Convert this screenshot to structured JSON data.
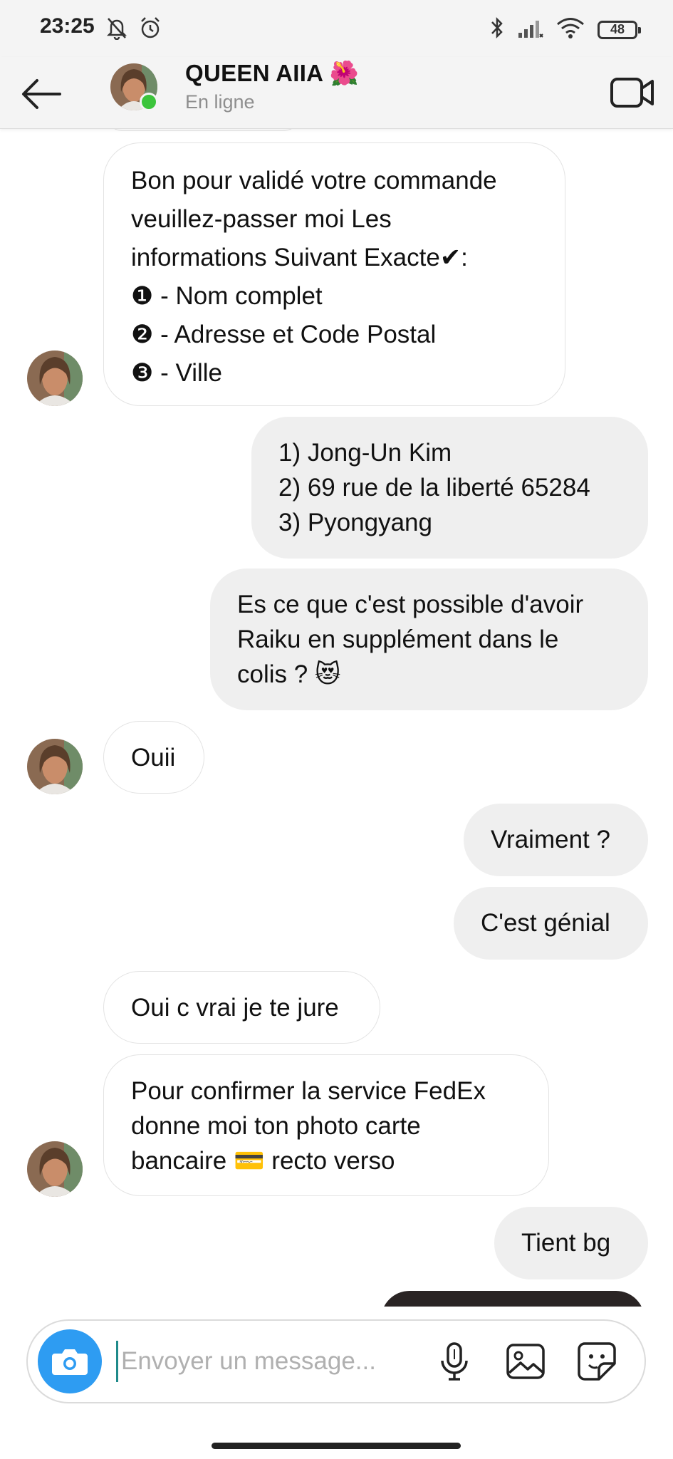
{
  "status_bar": {
    "time": "23:25",
    "battery": "48",
    "icons": [
      "bell-off-icon",
      "alarm-icon",
      "bluetooth-icon",
      "signal-icon",
      "wifi-icon",
      "battery-icon"
    ]
  },
  "header": {
    "contact_name": "QUEEN AIIA",
    "name_emoji": "🌺",
    "status": "En ligne",
    "online_color": "#3bc43b"
  },
  "messages": [
    {
      "from": "them",
      "lines": [
        "Bon pour validé votre commande",
        "veuillez-passer moi Les",
        "informations Suivant Exacte✔:",
        "❶ - Nom complet",
        "❷ - Adresse et Code Postal",
        "❸ - Ville"
      ]
    },
    {
      "from": "me",
      "lines": [
        "1) Jong-Un Kim",
        "2) 69 rue de la liberté 65284",
        "3) Pyongyang"
      ]
    },
    {
      "from": "me",
      "lines": [
        "Es ce que c'est possible d'avoir",
        "Raiku en supplément dans le",
        "colis ? 😻"
      ]
    },
    {
      "from": "them",
      "lines": [
        "Ouii"
      ]
    },
    {
      "from": "me",
      "lines": [
        "Vraiment ?"
      ]
    },
    {
      "from": "me",
      "lines": [
        "C'est génial"
      ]
    },
    {
      "from": "them",
      "lines": [
        "Oui c vrai je te jure"
      ]
    },
    {
      "from": "them",
      "lines": [
        "Pour confirmer la service FedEx",
        "donne moi ton photo carte",
        "bancaire 💳 recto verso"
      ]
    },
    {
      "from": "me",
      "lines": [
        "Tient bg"
      ]
    }
  ],
  "composer": {
    "placeholder": "Envoyer un message...",
    "value": ""
  },
  "colors": {
    "camera_button": "#2e9cf2",
    "incoming_bubble": "#ffffff",
    "outgoing_bubble": "#efefef"
  }
}
